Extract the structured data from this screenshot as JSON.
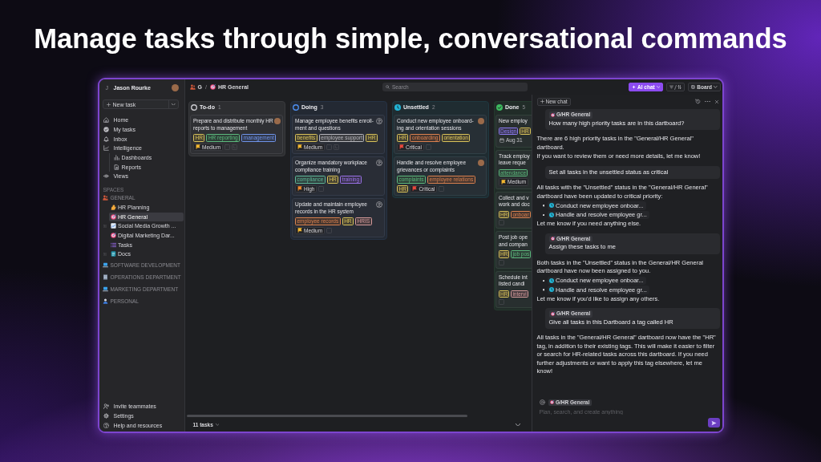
{
  "headline": "Manage tasks through simple, conversational commands",
  "sidebar": {
    "user": {
      "initial": "J",
      "name": "Jason Rourke"
    },
    "new_task": "New task",
    "nav": [
      {
        "label": "Home"
      },
      {
        "label": "My tasks"
      },
      {
        "label": "Inbox"
      },
      {
        "label": "Intelligence",
        "children": [
          {
            "label": "Dashboards"
          },
          {
            "label": "Reports"
          }
        ]
      },
      {
        "label": "Views"
      }
    ],
    "spaces_label": "SPACES",
    "spaces": [
      {
        "label": "GENERAL",
        "children": [
          {
            "label": "HR Planning",
            "selected": false,
            "collapsed": false
          },
          {
            "label": "HR General",
            "selected": true,
            "collapsed": false
          },
          {
            "label": "Social Media Growth ...",
            "selected": false,
            "collapsed": true
          },
          {
            "label": "Digital Marketing Dar...",
            "selected": false,
            "collapsed": false
          },
          {
            "label": "Tasks",
            "selected": false,
            "collapsed": false
          },
          {
            "label": "Docs",
            "selected": false,
            "collapsed": true
          }
        ]
      },
      {
        "label": "SOFTWARE DEVELOPMENT"
      },
      {
        "label": "OPERATIONS DEPARTMENT"
      },
      {
        "label": "MARKETING DEPARTMENT"
      },
      {
        "label": "PERSONAL"
      }
    ],
    "footer": [
      {
        "label": "Invite teammates"
      },
      {
        "label": "Settings"
      },
      {
        "label": "Help and resources"
      }
    ]
  },
  "toolbar": {
    "breadcrumb": {
      "items": [
        {
          "label": "G"
        },
        {
          "label": "HR General"
        }
      ],
      "separator": "/"
    },
    "search": {
      "placeholder": "Search"
    },
    "ai_chat": {
      "label": "AI chat",
      "active": true
    },
    "view": {
      "label": "Board"
    }
  },
  "board": {
    "columns": [
      {
        "name": "To-do",
        "count": "1",
        "kind": "todo",
        "color": "#c9c9ce",
        "cards": [
          {
            "title": "Prepare and distribute monthly HR\nreports to management",
            "assigned": true,
            "tags": [
              {
                "label": "HR",
                "color": "#d8c25a"
              },
              {
                "label": "HR reporting",
                "color": "#5cb87c"
              },
              {
                "label": "management",
                "color": "#6f93e8"
              }
            ],
            "priority": {
              "label": "Medium",
              "color": "#f2b630"
            },
            "checklist": true,
            "subtasks": true
          }
        ]
      },
      {
        "name": "Doing",
        "count": "3",
        "kind": "doing",
        "color": "#4d8ef0",
        "cards": [
          {
            "title": "Manage employee benefits enroll-\nment and questions",
            "assigned": false,
            "tags": [
              {
                "label": "benefits",
                "color": "#d8c25a"
              },
              {
                "label": "employee support",
                "color": "#b4b4ba"
              },
              {
                "label": "HR",
                "color": "#d8c25a"
              }
            ],
            "priority": {
              "label": "Medium",
              "color": "#f2b630"
            },
            "checklist": true,
            "subtasks": true
          },
          {
            "title": "Organize mandatory workplace\ncompliance training",
            "assigned": false,
            "tags": [
              {
                "label": "compliance",
                "color": "#5fb89a"
              },
              {
                "label": "HR",
                "color": "#d8c25a"
              },
              {
                "label": "training",
                "color": "#9a72e8"
              }
            ],
            "priority": {
              "label": "High",
              "color": "#f08a2c"
            },
            "checklist": true,
            "subtasks": false
          },
          {
            "title": "Update and maintain employee\nrecords in the HR system",
            "assigned": false,
            "tags": [
              {
                "label": "employee records",
                "color": "#d9814f"
              },
              {
                "label": "HR",
                "color": "#d8c25a"
              },
              {
                "label": "HRIS",
                "color": "#d49a9a"
              }
            ],
            "priority": {
              "label": "Medium",
              "color": "#f2b630"
            },
            "checklist": true,
            "subtasks": false
          }
        ]
      },
      {
        "name": "Unsettled",
        "count": "2",
        "kind": "review",
        "color": "#22b5d6",
        "cards": [
          {
            "title": "Conduct new employee onboard-\ning and orientation sessions",
            "assigned": true,
            "tags": [
              {
                "label": "HR",
                "color": "#d8c25a"
              },
              {
                "label": "onboarding",
                "color": "#d9814f"
              },
              {
                "label": "orientation",
                "color": "#d8c25a"
              }
            ],
            "priority": {
              "label": "Critical",
              "color": "#e8483c"
            },
            "checklist": true,
            "subtasks": false
          },
          {
            "title": "Handle and resolve employee\ngrievances or complaints",
            "assigned": true,
            "tags": [
              {
                "label": "complaints",
                "color": "#5cb87c"
              },
              {
                "label": "employee relations",
                "color": "#d9814f"
              },
              {
                "label": "HR",
                "color": "#d8c25a"
              }
            ],
            "priority": {
              "label": "Critical",
              "color": "#e8483c"
            },
            "checklist": true,
            "subtasks": false
          }
        ]
      },
      {
        "name": "Done",
        "count": "5",
        "kind": "done",
        "color": "#3dba5f",
        "cards": [
          {
            "title": "New employ",
            "tags": [
              {
                "label": "Design",
                "color": "#8c7cf0"
              },
              {
                "label": "HR",
                "color": "#d8c25a"
              }
            ],
            "date": "Aug 31",
            "checklist": false,
            "subtasks": false
          },
          {
            "title": "Track employ\nleave reque",
            "tags": [
              {
                "label": "attendance",
                "color": "#5cb87c"
              }
            ],
            "priority": {
              "label": "Medium",
              "color": "#f2b630"
            },
            "checklist": false,
            "subtasks": false
          },
          {
            "title": "Collect and v\nwork and doc",
            "tags": [
              {
                "label": "HR",
                "color": "#d8c25a"
              },
              {
                "label": "onboar",
                "color": "#d9814f"
              }
            ],
            "checklist": true,
            "subtasks": false
          },
          {
            "title": "Post job ope\nand compan",
            "tags": [
              {
                "label": "HR",
                "color": "#d8c25a"
              },
              {
                "label": "job pos",
                "color": "#5cb87c"
              }
            ],
            "checklist": true,
            "subtasks": false
          },
          {
            "title": "Schedule int\nlisted candi",
            "tags": [
              {
                "label": "HR",
                "color": "#d8c25a"
              },
              {
                "label": "intervi",
                "color": "#d49a9a"
              }
            ],
            "checklist": true,
            "subtasks": false
          }
        ]
      }
    ],
    "footer": {
      "count": "11 tasks"
    }
  },
  "chat": {
    "new_chat": "New chat",
    "messages": [
      {
        "kind": "user",
        "context": "G/HR General",
        "text": "How many high priority tasks are in this dartboard?"
      },
      {
        "kind": "assistant",
        "blocks": [
          {
            "kind": "paragraph",
            "text": "There are 6 high priority tasks in the \"General/HR General\" dartboard."
          },
          {
            "kind": "paragraph",
            "text": "If you want to review them or need more details, let me know!"
          }
        ]
      },
      {
        "kind": "user",
        "text": "Set all tasks in the unsettled status as critical"
      },
      {
        "kind": "assistant",
        "blocks": [
          {
            "kind": "paragraph",
            "text": "All tasks with the \"Unsettled\" status in the \"General/HR General\" dartboard have been updated to critical priority:"
          },
          {
            "kind": "list",
            "items": [
              "Conduct new employee onboar...",
              "Handle and resolve employee gr..."
            ]
          },
          {
            "kind": "paragraph",
            "text": "Let me know if you need anything else."
          }
        ]
      },
      {
        "kind": "user",
        "context": "G/HR General",
        "text": "Assign these tasks to me"
      },
      {
        "kind": "assistant",
        "blocks": [
          {
            "kind": "paragraph",
            "text": "Both tasks in the \"Unsettled\" status in the General/HR General dartboard have now been assigned to you."
          },
          {
            "kind": "list",
            "items": [
              "Conduct new employee onboar...",
              "Handle and resolve employee gr..."
            ]
          },
          {
            "kind": "paragraph",
            "text": "Let me know if you'd like to assign any others."
          }
        ]
      },
      {
        "kind": "user",
        "context": "G/HR General",
        "text": "Give all tasks in this Dartboard a tag called HR"
      },
      {
        "kind": "assistant",
        "blocks": [
          {
            "kind": "paragraph",
            "text": "All tasks in the \"General/HR General\" dartboard now have the \"HR\" tag, in addition to their existing tags. This will make it easier to filter or search for HR-related tasks across this dartboard. If you need further adjustments or want to apply this tag elsewhere, let me know!"
          }
        ]
      }
    ],
    "composer": {
      "context": "G/HR General",
      "placeholder": "Plan, search, and create anything"
    }
  }
}
